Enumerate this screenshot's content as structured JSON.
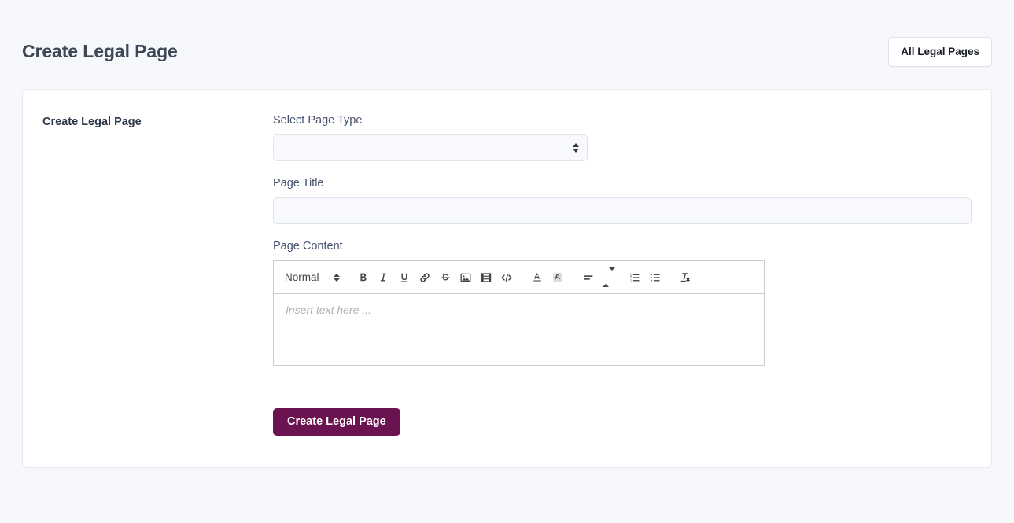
{
  "header": {
    "title": "Create Legal Page",
    "all_pages_button": "All Legal Pages"
  },
  "card": {
    "section_title": "Create Legal Page",
    "fields": {
      "page_type": {
        "label": "Select Page Type",
        "value": "",
        "options": [
          ""
        ]
      },
      "page_title": {
        "label": "Page Title",
        "value": "",
        "placeholder": ""
      },
      "page_content": {
        "label": "Page Content",
        "placeholder": "Insert text here ...",
        "value": ""
      }
    },
    "editor_toolbar": {
      "format_picker": "Normal",
      "buttons": [
        {
          "name": "bold-icon",
          "title": "Bold"
        },
        {
          "name": "italic-icon",
          "title": "Italic"
        },
        {
          "name": "underline-icon",
          "title": "Underline"
        },
        {
          "name": "link-icon",
          "title": "Link"
        },
        {
          "name": "strikethrough-icon",
          "title": "Strike"
        },
        {
          "name": "image-icon",
          "title": "Image"
        },
        {
          "name": "video-icon",
          "title": "Video"
        },
        {
          "name": "code-block-icon",
          "title": "Code Block"
        },
        {
          "name": "text-color-icon",
          "title": "Text Color"
        },
        {
          "name": "background-color-icon",
          "title": "Background Color"
        },
        {
          "name": "align-icon",
          "title": "Align"
        },
        {
          "name": "ordered-list-icon",
          "title": "Ordered List"
        },
        {
          "name": "bullet-list-icon",
          "title": "Bullet List"
        },
        {
          "name": "clear-format-icon",
          "title": "Clear Formatting"
        }
      ]
    },
    "submit_button": "Create Legal Page"
  },
  "colors": {
    "page_background": "#f7f8fc",
    "card_background": "#ffffff",
    "card_border": "#e7eaf1",
    "title_text": "#3c4858",
    "label_text": "#46526b",
    "input_background": "#f7f9fc",
    "input_border": "#dfe3ec",
    "primary_button": "#6b1350",
    "editor_border": "#cccccc",
    "placeholder_text": "#b0b0b0"
  }
}
